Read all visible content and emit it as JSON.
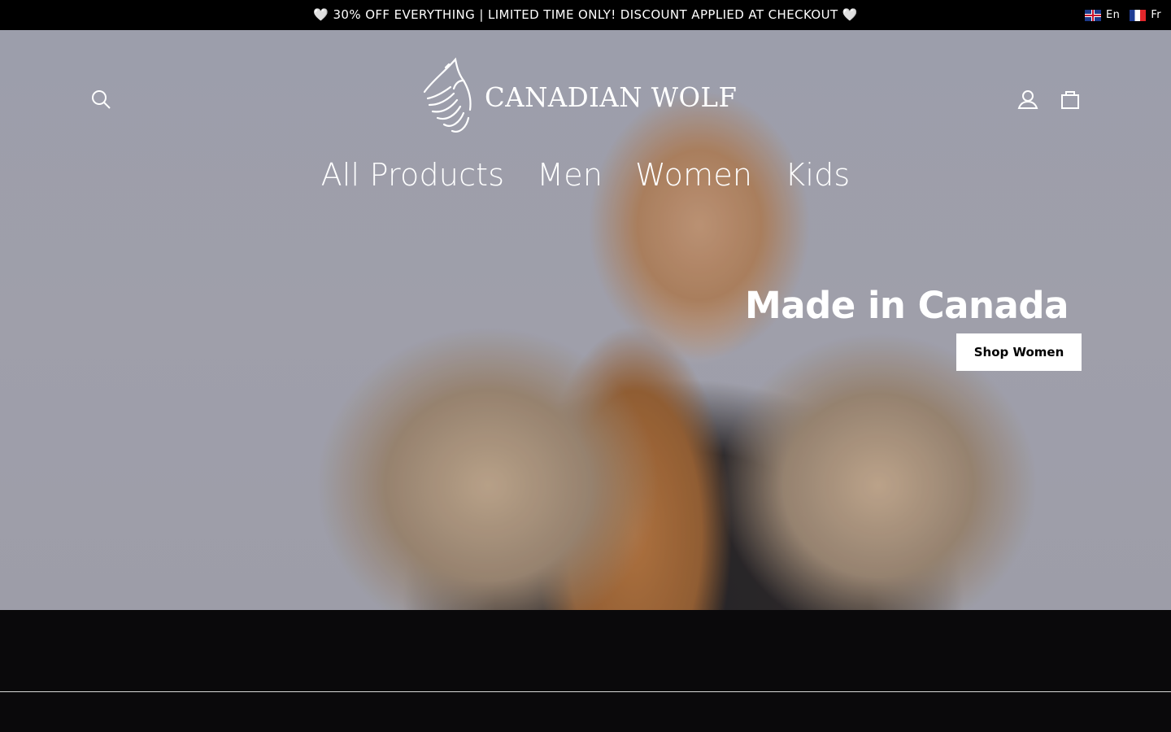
{
  "announcement": {
    "heart_left": "🤍",
    "text": "30% OFF EVERYTHING | LIMITED TIME ONLY! DISCOUNT APPLIED AT CHECKOUT",
    "heart_right": "🤍"
  },
  "languages": [
    {
      "code": "En",
      "flag": "uk-flag-icon"
    },
    {
      "code": "Fr",
      "flag": "france-flag-icon"
    }
  ],
  "brand": {
    "name": "CANADIAN WOLF",
    "logo_icon": "howling-wolf-icon"
  },
  "header_icons": {
    "search": "search-icon",
    "account": "account-icon",
    "cart": "cart-icon"
  },
  "nav": {
    "items": [
      "All Products",
      "Men",
      "Women",
      "Kids"
    ]
  },
  "hero": {
    "title": "Made in Canada",
    "button_label": "Shop Women",
    "image": "woman in black parka with fur-trimmed hood"
  },
  "colors": {
    "announcement_bg": "#000000",
    "footer_bg": "#0a090b",
    "button_bg": "#ffffff",
    "text_light": "#ffffff"
  }
}
